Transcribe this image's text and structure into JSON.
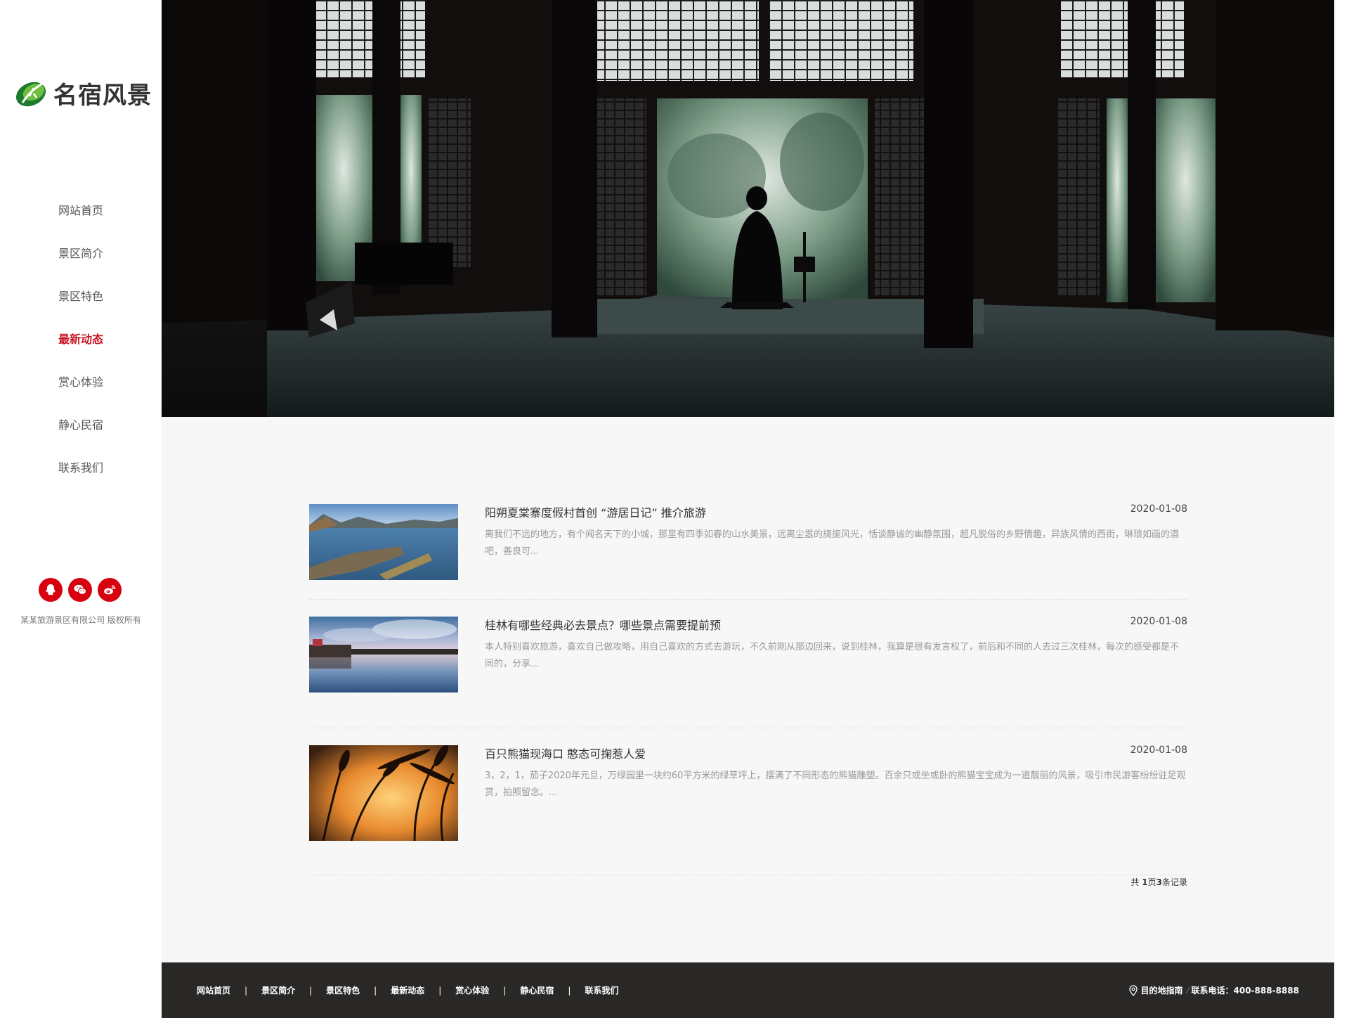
{
  "brand": {
    "name": "名宿风景",
    "logo_icon": "leaf-logo-icon",
    "accent": "#c81623"
  },
  "sidebar": {
    "nav": [
      {
        "label": "网站首页",
        "active": false
      },
      {
        "label": "景区简介",
        "active": false
      },
      {
        "label": "景区特色",
        "active": false
      },
      {
        "label": "最新动态",
        "active": true
      },
      {
        "label": "赏心体验",
        "active": false
      },
      {
        "label": "静心民宿",
        "active": false
      },
      {
        "label": "联系我们",
        "active": false
      }
    ],
    "social": [
      {
        "icon": "qq-icon"
      },
      {
        "icon": "wechat-icon"
      },
      {
        "icon": "weibo-icon"
      }
    ],
    "copyright": "某某旅游景区有限公司 版权所有"
  },
  "news": [
    {
      "title": "阳朔夏棠寨度假村首创 “游居日记” 推介旅游",
      "date": "2020-01-08",
      "summary": "离我们不远的地方，有个闻名天下的小城，那里有四季如春的山水美景，远离尘嚣的旖旎风光，恬谈静谧的幽静氛围，超凡脱俗的乡野情趣，异族风情的西街，琳琅如画的酒吧，善良可..."
    },
    {
      "title": "桂林有哪些经典必去景点？哪些景点需要提前预",
      "date": "2020-01-08",
      "summary": "本人特别喜欢旅游，喜欢自己做攻略，用自己喜欢的方式去游玩，不久前刚从那边回来，说到桂林，我算是很有发言权了，前后和不同的人去过三次桂林，每次的感受都是不同的，分享..."
    },
    {
      "title": "百只熊猫现海口 憨态可掬惹人爱",
      "date": "2020-01-08",
      "summary": "3，2，1，茄子2020年元旦，万绿园里一块约60平方米的绿草坪上，摆满了不同形态的熊猫雕塑。百余只或坐或卧的熊猫宝宝成为一道靓丽的风景，吸引市民游客纷纷驻足观赏，拍照留念。..."
    }
  ],
  "pagination": {
    "prefix": "共 ",
    "pages": "1",
    "mid": "页",
    "records": "3",
    "suffix": "条记录"
  },
  "footer": {
    "links": [
      "网站首页",
      "景区简介",
      "景区特色",
      "最新动态",
      "赏心体验",
      "静心民宿",
      "联系我们"
    ],
    "separator": "|",
    "guide_label": "目的地指南",
    "phone_label": "联系电话：400-888-8888"
  }
}
